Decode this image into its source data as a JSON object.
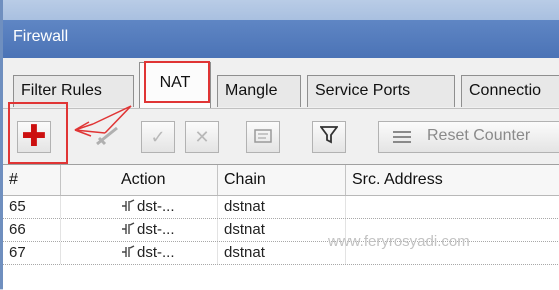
{
  "window": {
    "title": "Firewall"
  },
  "tabs": [
    {
      "label": "Filter Rules",
      "active": false
    },
    {
      "label": "NAT",
      "active": true
    },
    {
      "label": "Mangle",
      "active": false
    },
    {
      "label": "Service Ports",
      "active": false
    },
    {
      "label": "Connectio",
      "active": false
    }
  ],
  "toolbar": {
    "reset_label": "Reset Counter"
  },
  "table": {
    "columns": [
      "#",
      "Action",
      "Chain",
      "Src. Address"
    ],
    "rows": [
      {
        "num": "65",
        "action": "dst-...",
        "chain": "dstnat",
        "src": ""
      },
      {
        "num": "66",
        "action": "dst-...",
        "chain": "dstnat",
        "src": ""
      },
      {
        "num": "67",
        "action": "dst-...",
        "chain": "dstnat",
        "src": ""
      }
    ]
  },
  "watermark": "www.feryrosyadi.com",
  "colors": {
    "highlight": "#e03535",
    "titlebar": "#4b73b6",
    "add_icon": "#cc1010"
  },
  "icons": [
    "add-icon",
    "remove-icon",
    "enable-icon",
    "disable-icon",
    "comment-icon",
    "filter-icon",
    "reset-counter-icon",
    "action-icon"
  ]
}
